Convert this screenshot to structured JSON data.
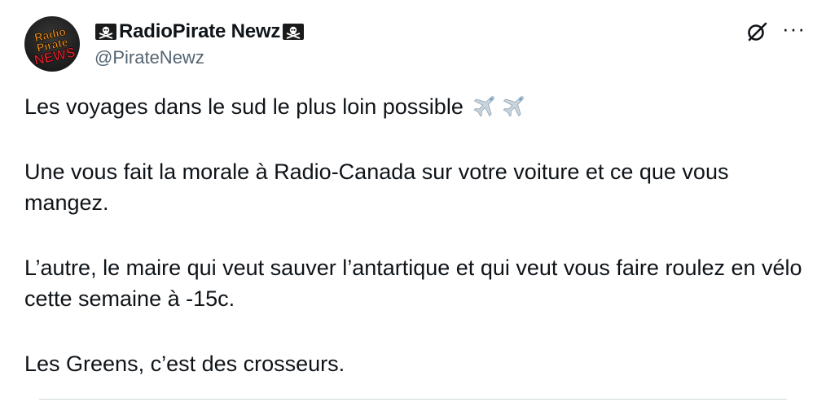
{
  "tweet": {
    "author_name": "RadioPirate Newz",
    "author_name_prefix_icon": "skull-crossbones-flag",
    "author_name_suffix_icon": "skull-crossbones-flag",
    "handle": "@PirateNewz",
    "avatar_logo": [
      "Radio",
      "Pirate",
      "NEWS"
    ],
    "menu_label": "···",
    "grok_icon": "grok-icon",
    "paragraphs": [
      "Les voyages dans le sud le plus loin possible",
      "Une vous fait la morale à Radio-Canada sur votre voiture et ce que vous mangez.",
      "L’autre, le maire qui veut sauver l’antartique et qui veut vous faire roulez en vélo cette semaine à -15c.",
      "Les Greens, c’est des crosseurs."
    ],
    "emoji": "airplane"
  },
  "colors": {
    "text": "#0f1419",
    "secondary": "#536471",
    "logo_red": "#e8202a",
    "logo_orange": "#f7941d"
  }
}
